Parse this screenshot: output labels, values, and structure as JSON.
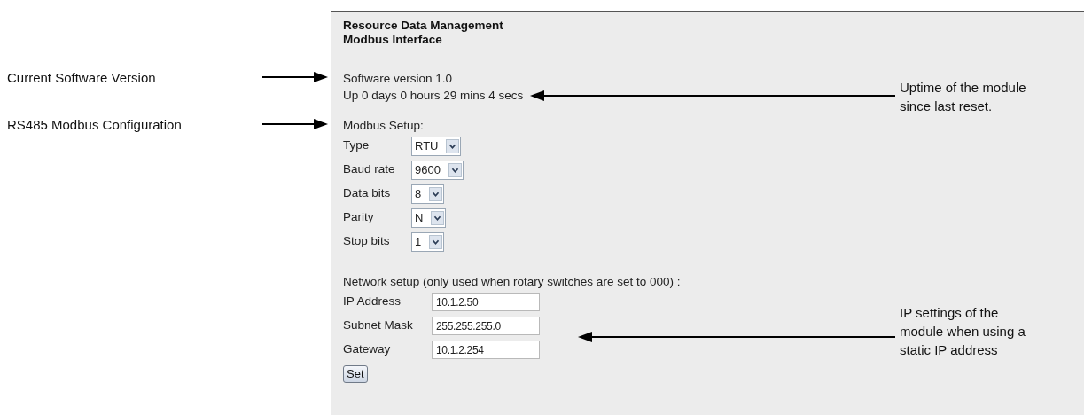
{
  "header": {
    "title_lines": [
      "Resource Data Management",
      "Modbus Interface"
    ]
  },
  "status": {
    "version": "Software version 1.0",
    "uptime": "Up 0 days 0 hours 29 mins 4 secs"
  },
  "modbus_setup": {
    "heading": "Modbus Setup:",
    "fields": [
      {
        "label": "Type",
        "value": "RTU"
      },
      {
        "label": "Baud rate",
        "value": "9600"
      },
      {
        "label": "Data bits",
        "value": "8"
      },
      {
        "label": "Parity",
        "value": "N"
      },
      {
        "label": "Stop bits",
        "value": "1"
      }
    ]
  },
  "network_setup": {
    "heading": "Network setup (only used when rotary switches are set to 000) :",
    "fields": [
      {
        "label": "IP Address",
        "value": "10.1.2.50"
      },
      {
        "label": "Subnet Mask",
        "value": "255.255.255.0"
      },
      {
        "label": "Gateway",
        "value": "10.1.2.254"
      }
    ]
  },
  "buttons": [
    "Set"
  ],
  "annotations": [
    {
      "kind": "left",
      "lines": [
        "Current Software Version"
      ]
    },
    {
      "kind": "left",
      "lines": [
        "RS485 Modbus Configuration"
      ]
    },
    {
      "kind": "right",
      "lines": [
        "Uptime of the module",
        "since last reset."
      ]
    },
    {
      "kind": "right",
      "lines": [
        "IP settings of the",
        "module when using a",
        "static IP address"
      ]
    }
  ]
}
